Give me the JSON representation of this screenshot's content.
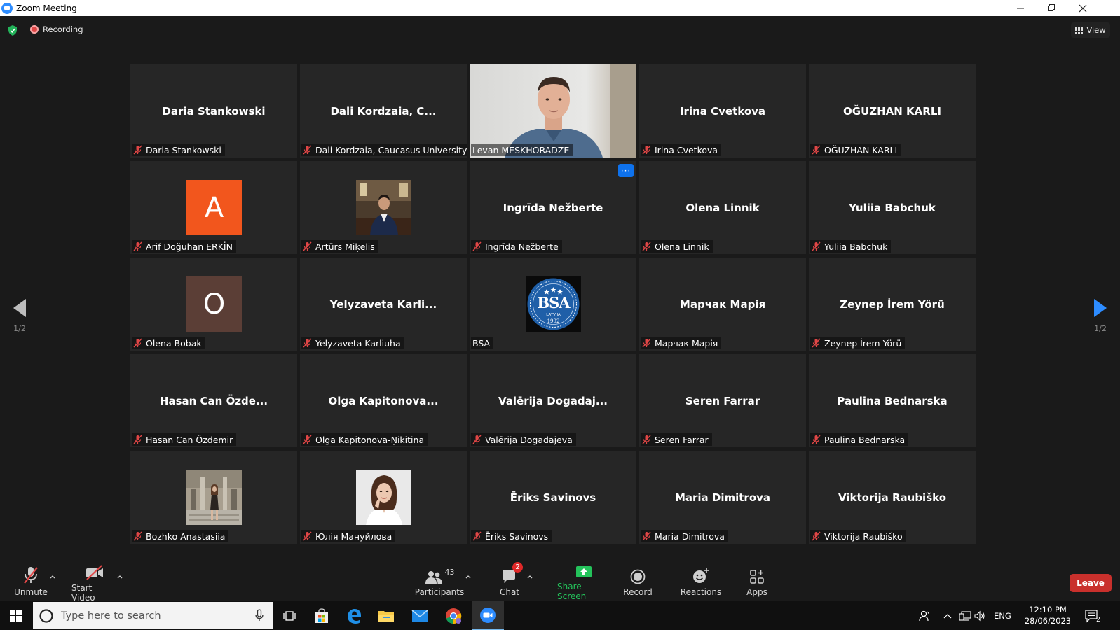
{
  "window": {
    "title": "Zoom Meeting"
  },
  "topbar": {
    "recording": "Recording",
    "view": "View"
  },
  "nav": {
    "page_left": "1/2",
    "page_right": "1/2"
  },
  "tiles": [
    {
      "big": "Daria Stankowski",
      "label": "Daria Stankowski"
    },
    {
      "big": "Dali Kordzaia, C...",
      "label": "Dali Kordzaia, Caucasus University"
    },
    {
      "big": "",
      "label": "Levan MESKHORADZE"
    },
    {
      "big": "Irina Cvetkova",
      "label": "Irina Cvetkova"
    },
    {
      "big": "OĞUZHAN KARLI",
      "label": "OĞUZHAN KARLI"
    },
    {
      "big": "",
      "label": "Arif Doğuhan ERKİN",
      "avatar_letter": "A"
    },
    {
      "big": "",
      "label": "Artūrs Miķelis"
    },
    {
      "big": "Ingrīda Nežberte",
      "label": "Ingrīda Nežberte"
    },
    {
      "big": "Olena Linnik",
      "label": "Olena Linnik"
    },
    {
      "big": "Yuliia Babchuk",
      "label": "Yuliia Babchuk"
    },
    {
      "big": "",
      "label": "Olena Bobak",
      "avatar_letter": "O"
    },
    {
      "big": "Yelyzaveta Karli...",
      "label": "Yelyzaveta Karliuha"
    },
    {
      "big": "",
      "label": "BSA",
      "logo_text": "BSA",
      "logo_sub": "LATVIJA",
      "logo_year": "1992"
    },
    {
      "big": "Марчак Марія",
      "label": "Марчак Марія"
    },
    {
      "big": "Zeynep İrem Yörü",
      "label": "Zeynep İrem Yörü"
    },
    {
      "big": "Hasan Can Özde...",
      "label": "Hasan Can Özdemir"
    },
    {
      "big": "Olga Kapitonova...",
      "label": "Olga Kapitonova-Ņikitina"
    },
    {
      "big": "Valērija Dogadaj...",
      "label": "Valērija Dogadajeva"
    },
    {
      "big": "Seren Farrar",
      "label": "Seren Farrar"
    },
    {
      "big": "Paulina Bednarska",
      "label": "Paulina Bednarska"
    },
    {
      "big": "",
      "label": "Bozhko Anastasiia"
    },
    {
      "big": "",
      "label": "Юлія Мануйлова"
    },
    {
      "big": "Ēriks Savinovs",
      "label": "Ēriks Savinovs"
    },
    {
      "big": "Maria Dimitrova",
      "label": "Maria Dimitrova"
    },
    {
      "big": "Viktorija Raubiško",
      "label": "Viktorija Raubiško"
    }
  ],
  "toolbar": {
    "unmute": "Unmute",
    "start_video": "Start Video",
    "participants": "Participants",
    "participants_count": "43",
    "chat": "Chat",
    "chat_badge": "2",
    "share_screen": "Share Screen",
    "record": "Record",
    "reactions": "Reactions",
    "apps": "Apps",
    "leave": "Leave"
  },
  "taskbar": {
    "search_placeholder": "Type here to search",
    "lang": "ENG",
    "time": "12:10 PM",
    "date": "28/06/2023",
    "notifications": "2"
  },
  "colors": {
    "accent": "#0e72ed",
    "share_green": "#24c35b",
    "leave_red": "#c9302c",
    "active_speaker": "#c7e35b",
    "avatar_orange": "#f2561d",
    "avatar_brown": "#5b3e36"
  }
}
